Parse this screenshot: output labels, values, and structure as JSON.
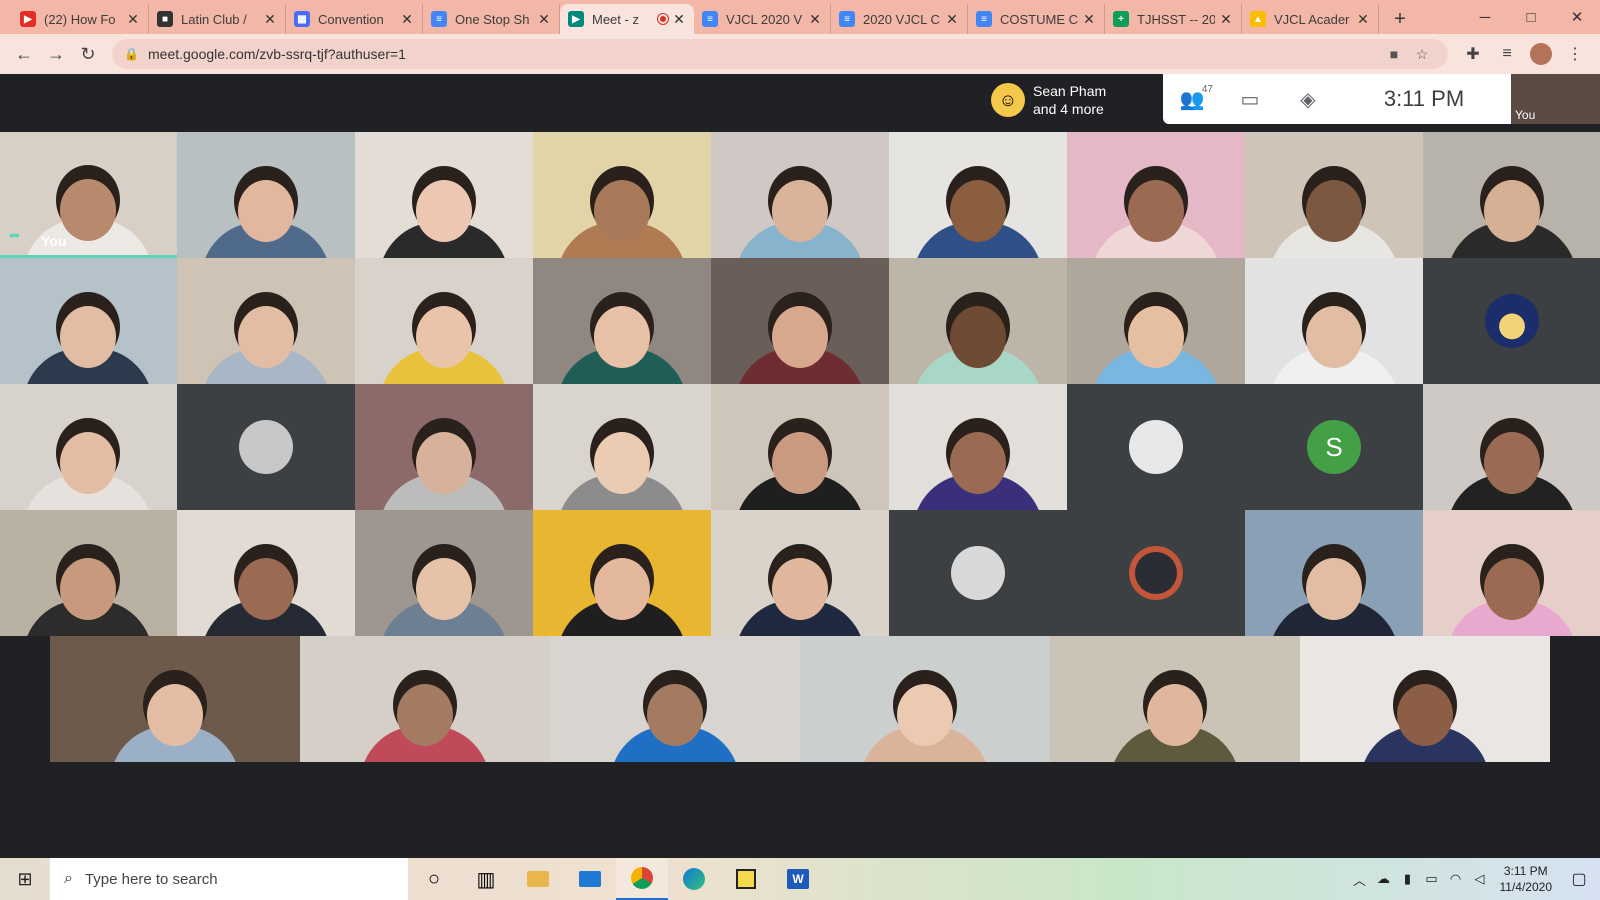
{
  "browser": {
    "tabs": [
      {
        "title": "(22) How Fo",
        "fav_color": "#e52d27",
        "fav_glyph": "▶"
      },
      {
        "title": "Latin Club /",
        "fav_color": "#333333",
        "fav_glyph": "■"
      },
      {
        "title": "Convention",
        "fav_color": "#4a6cf7",
        "fav_glyph": "▦"
      },
      {
        "title": "One Stop Sh",
        "fav_color": "#4285f4",
        "fav_glyph": "≡"
      },
      {
        "title": "Meet - z",
        "fav_color": "#00897b",
        "fav_glyph": "▶",
        "active": true
      },
      {
        "title": "VJCL 2020 V",
        "fav_color": "#4285f4",
        "fav_glyph": "≡"
      },
      {
        "title": "2020 VJCL C",
        "fav_color": "#4285f4",
        "fav_glyph": "≡"
      },
      {
        "title": "COSTUME C",
        "fav_color": "#4285f4",
        "fav_glyph": "≡"
      },
      {
        "title": "TJHSST -- 20",
        "fav_color": "#0f9d58",
        "fav_glyph": "+"
      },
      {
        "title": "VJCL Acader",
        "fav_color": "#fbbc04",
        "fav_glyph": "▲"
      }
    ],
    "new_tab": "+",
    "url": "meet.google.com/zvb-ssrq-tjf?authuser=1"
  },
  "meet": {
    "presenter_line1": "Sean Pham",
    "presenter_line2": "and 4 more",
    "participant_count": "47",
    "time": "3:11 PM",
    "self_label": "You",
    "tiles": [
      {
        "label": "You",
        "bg": "#d8cfc6",
        "skin": "#b78a6e",
        "shirt": "#ece8e4",
        "self": true
      },
      {
        "bg": "#b9c0c2",
        "skin": "#e2b79e",
        "shirt": "#4f6a8a"
      },
      {
        "bg": "#e3ddd6",
        "skin": "#eec7b3",
        "shirt": "#2a2a2a"
      },
      {
        "bg": "#e2d4a6",
        "skin": "#a87a5a",
        "shirt": "#b07a52"
      },
      {
        "bg": "#cfc8c4",
        "skin": "#d9b49a",
        "shirt": "#88b3cc"
      },
      {
        "bg": "#e6e4e0",
        "skin": "#8b5e40",
        "shirt": "#2f4f88"
      },
      {
        "bg": "#e5b8c8",
        "skin": "#9a6a52",
        "shirt": "#f0d7d7"
      },
      {
        "bg": "#cfc4b8",
        "skin": "#7d5840",
        "shirt": "#e8e6e2"
      },
      {
        "bg": "#b7b2aa",
        "skin": "#d6b094",
        "shirt": "#2a2a2a"
      },
      {
        "bg": "#b6c2c9",
        "skin": "#e2bca3",
        "shirt": "#2c3a4d"
      },
      {
        "bg": "#cfc3b5",
        "skin": "#e2bca3",
        "shirt": "#a9b6c5"
      },
      {
        "bg": "#d9d2ca",
        "skin": "#e9c4aa",
        "shirt": "#e8c23a"
      },
      {
        "bg": "#8f8780",
        "skin": "#e7c0a6",
        "shirt": "#1f5d56"
      },
      {
        "bg": "#6a5e58",
        "skin": "#d8a88c",
        "shirt": "#6e2d33"
      },
      {
        "bg": "#bdb6a8",
        "skin": "#6f4a32",
        "shirt": "#a9d7c7"
      },
      {
        "bg": "#b0a79c",
        "skin": "#e6bfa3",
        "shirt": "#79b7e0"
      },
      {
        "bg": "#e2e2e2",
        "skin": "#e2bca3",
        "shirt": "#f0f0f0"
      },
      {
        "avatar": "moon",
        "bg": "#3c4043",
        "circle": "#1b2d6b"
      },
      {
        "bg": "#d7d2cc",
        "skin": "#e2bca3",
        "shirt": "#e6e1dc"
      },
      {
        "avatar": "sphere",
        "bg": "#3c4043",
        "circle": "#c8c8c8"
      },
      {
        "bg": "#8c6a6a",
        "skin": "#d7b19a",
        "shirt": "#bcbcbc"
      },
      {
        "bg": "#d9d4cd",
        "skin": "#eccbb3",
        "shirt": "#8c8c8c"
      },
      {
        "bg": "#cfc6bb",
        "skin": "#c99a7e",
        "shirt": "#1f1f1f"
      },
      {
        "bg": "#e2ded9",
        "skin": "#9a6a52",
        "shirt": "#3a2f7a"
      },
      {
        "avatar": "bird",
        "bg": "#3c4043",
        "circle": "#e8e8e8"
      },
      {
        "avatar": "letter",
        "letter": "S",
        "bg": "#3c4043",
        "circle": "#43a047"
      },
      {
        "bg": "#cfc9c6",
        "skin": "#9a6a52",
        "shirt": "#222222"
      },
      {
        "bg": "#b9b1a2",
        "skin": "#c89a7d",
        "shirt": "#2c2c2c"
      },
      {
        "bg": "#e2dbd3",
        "skin": "#9a6a52",
        "shirt": "#262a34"
      },
      {
        "bg": "#9e978f",
        "skin": "#e6c3a8",
        "shirt": "#6d7f93"
      },
      {
        "bg": "#e8b630",
        "skin": "#e4b89c",
        "shirt": "#1f1f1f"
      },
      {
        "bg": "#d9d3ca",
        "skin": "#e0b79c",
        "shirt": "#1f2a40"
      },
      {
        "avatar": "eclipse",
        "bg": "#3c4043",
        "circle": "#d8d8d8"
      },
      {
        "avatar": "ring",
        "bg": "#3c4043",
        "circle": "#2a2d33"
      },
      {
        "bg": "#8aa0b6",
        "skin": "#e2bca3",
        "shirt": "#202636"
      },
      {
        "bg": "#e6cfc8",
        "skin": "#9a6a52",
        "shirt": "#e8a9cf"
      },
      {
        "bg": "#6e5a4a",
        "skin": "#e2bca3",
        "shirt": "#9bb0c6"
      },
      {
        "bg": "#d6cfc7",
        "skin": "#a47a60",
        "shirt": "#c04a5a"
      },
      {
        "bg": "#d8d4d0",
        "skin": "#a47a60",
        "shirt": "#1f6fc4"
      },
      {
        "bg": "#cbd0cf",
        "skin": "#ebcab1",
        "shirt": "#dbb39b"
      },
      {
        "bg": "#cbc3b6",
        "skin": "#e0b79c",
        "shirt": "#5e5a3e"
      },
      {
        "bg": "#eae6e4",
        "skin": "#8c5e46",
        "shirt": "#2a3460"
      }
    ]
  },
  "taskbar": {
    "search_placeholder": "Type here to search",
    "clock_time": "3:11 PM",
    "clock_date": "11/4/2020"
  },
  "icons": {
    "close": "✕",
    "back": "←",
    "forward": "→",
    "reload": "↻",
    "lock": "🔒",
    "camera": "■",
    "star": "☆",
    "extensions": "✚",
    "media": "≡",
    "menu": "⋮",
    "people": "👥",
    "chat": "▭",
    "activities": "◈",
    "start": "⊞",
    "search": "⌕",
    "cortana": "○",
    "taskview": "▥",
    "minimize": "─",
    "maximize": "□"
  }
}
